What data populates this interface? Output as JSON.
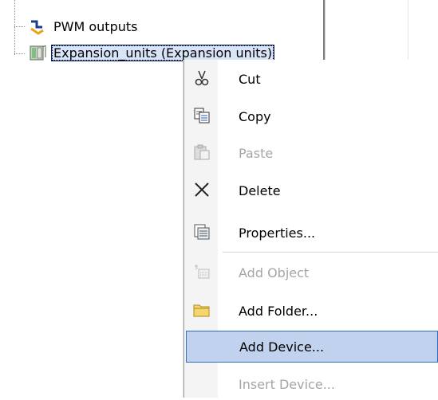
{
  "tree": {
    "items": [
      {
        "label": "PWM outputs",
        "icon": "pwm-output-icon",
        "selected": false
      },
      {
        "label": "Expansion_units (Expansion units)",
        "icon": "expansion-unit-icon",
        "selected": true
      }
    ]
  },
  "context_menu": {
    "items": [
      {
        "label": "Cut",
        "icon": "scissors-icon",
        "enabled": true
      },
      {
        "label": "Copy",
        "icon": "copy-icon",
        "enabled": true
      },
      {
        "label": "Paste",
        "icon": "paste-icon",
        "enabled": false
      },
      {
        "label": "Delete",
        "icon": "delete-x-icon",
        "enabled": true
      },
      {
        "label": "Properties...",
        "icon": "properties-icon",
        "enabled": true
      },
      {
        "label": "Add Object",
        "icon": "add-object-icon",
        "enabled": false
      },
      {
        "label": "Add Folder...",
        "icon": "folder-icon",
        "enabled": true
      },
      {
        "label": "Add Device...",
        "icon": "",
        "enabled": true,
        "highlighted": true
      },
      {
        "label": "Insert Device...",
        "icon": "",
        "enabled": false
      }
    ]
  },
  "colors": {
    "selection_bg": "#d8e4f8",
    "menu_highlight_bg": "#c1d2ee",
    "menu_highlight_border": "#316ac5",
    "disabled_text": "#a5a5a5"
  }
}
